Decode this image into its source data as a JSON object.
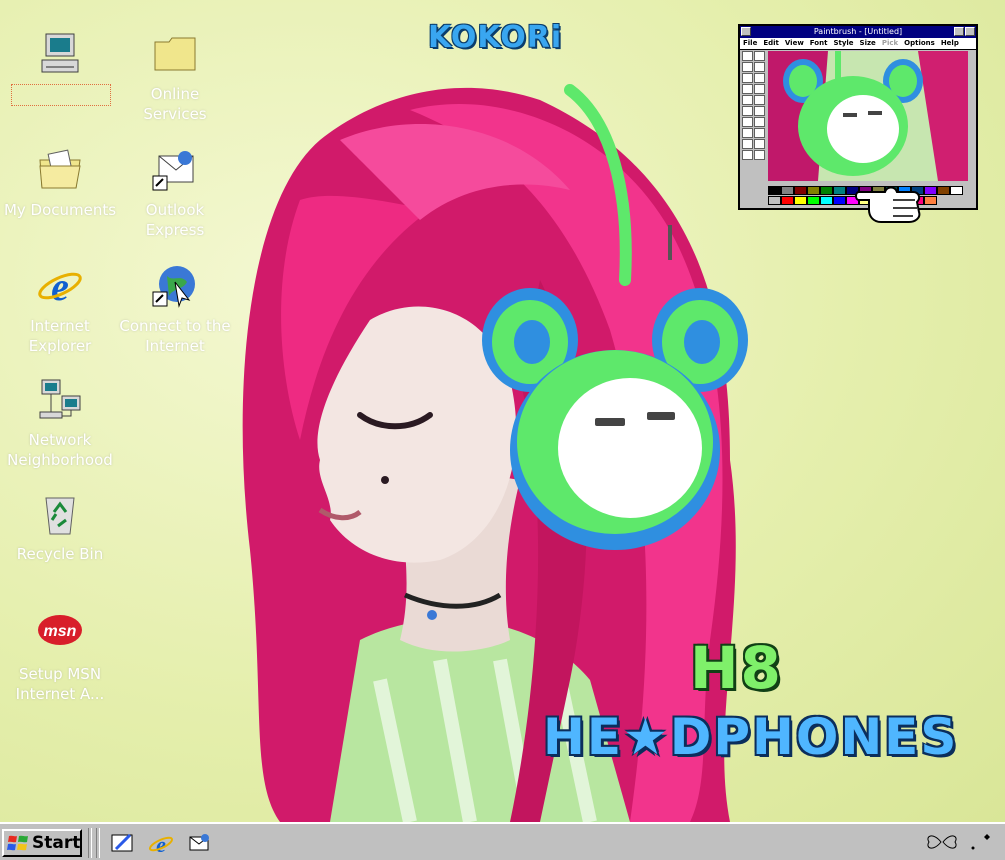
{
  "title_text": "KOKORi",
  "caption": {
    "line1": "H8",
    "line2": "HE★DPHONES"
  },
  "desktop_icons": [
    {
      "name": "my-computer",
      "label": ""
    },
    {
      "name": "online-services",
      "label": "Online Services"
    },
    {
      "name": "my-documents",
      "label": "My Documents"
    },
    {
      "name": "outlook-express",
      "label": "Outlook Express"
    },
    {
      "name": "internet-explorer",
      "label": "Internet Explorer"
    },
    {
      "name": "connect-internet",
      "label": "Connect to the Internet"
    },
    {
      "name": "network-neighborhood",
      "label": "Network Neighborhood"
    },
    {
      "name": "recycle-bin",
      "label": "Recycle Bin"
    },
    {
      "name": "setup-msn",
      "label": "Setup MSN Internet A..."
    }
  ],
  "paint_window": {
    "title": "Paintbrush - [Untitled]",
    "menu": [
      "File",
      "Edit",
      "View",
      "Font",
      "Style",
      "Size",
      "Pick",
      "Options",
      "Help"
    ],
    "disabled_menu": "Pick",
    "palette": [
      "#000000",
      "#808080",
      "#800000",
      "#808000",
      "#008000",
      "#008080",
      "#000080",
      "#800080",
      "#808040",
      "#004040",
      "#0080ff",
      "#004080",
      "#8000ff",
      "#804000",
      "#ffffff",
      "#c0c0c0",
      "#ff0000",
      "#ffff00",
      "#00ff00",
      "#00ffff",
      "#0000ff",
      "#ff00ff",
      "#ffff80",
      "#00ff80",
      "#80ffff",
      "#8080ff",
      "#ff0080",
      "#ff8040"
    ]
  },
  "taskbar": {
    "start_label": "Start"
  },
  "icons": {
    "msn_logo_text": "msn"
  },
  "colors": {
    "hair": "#e8217a",
    "headphone_green": "#5ee86b",
    "headphone_blue": "#2f8fe0",
    "background": "#e5efad",
    "taskbar": "#c0c0c0"
  }
}
